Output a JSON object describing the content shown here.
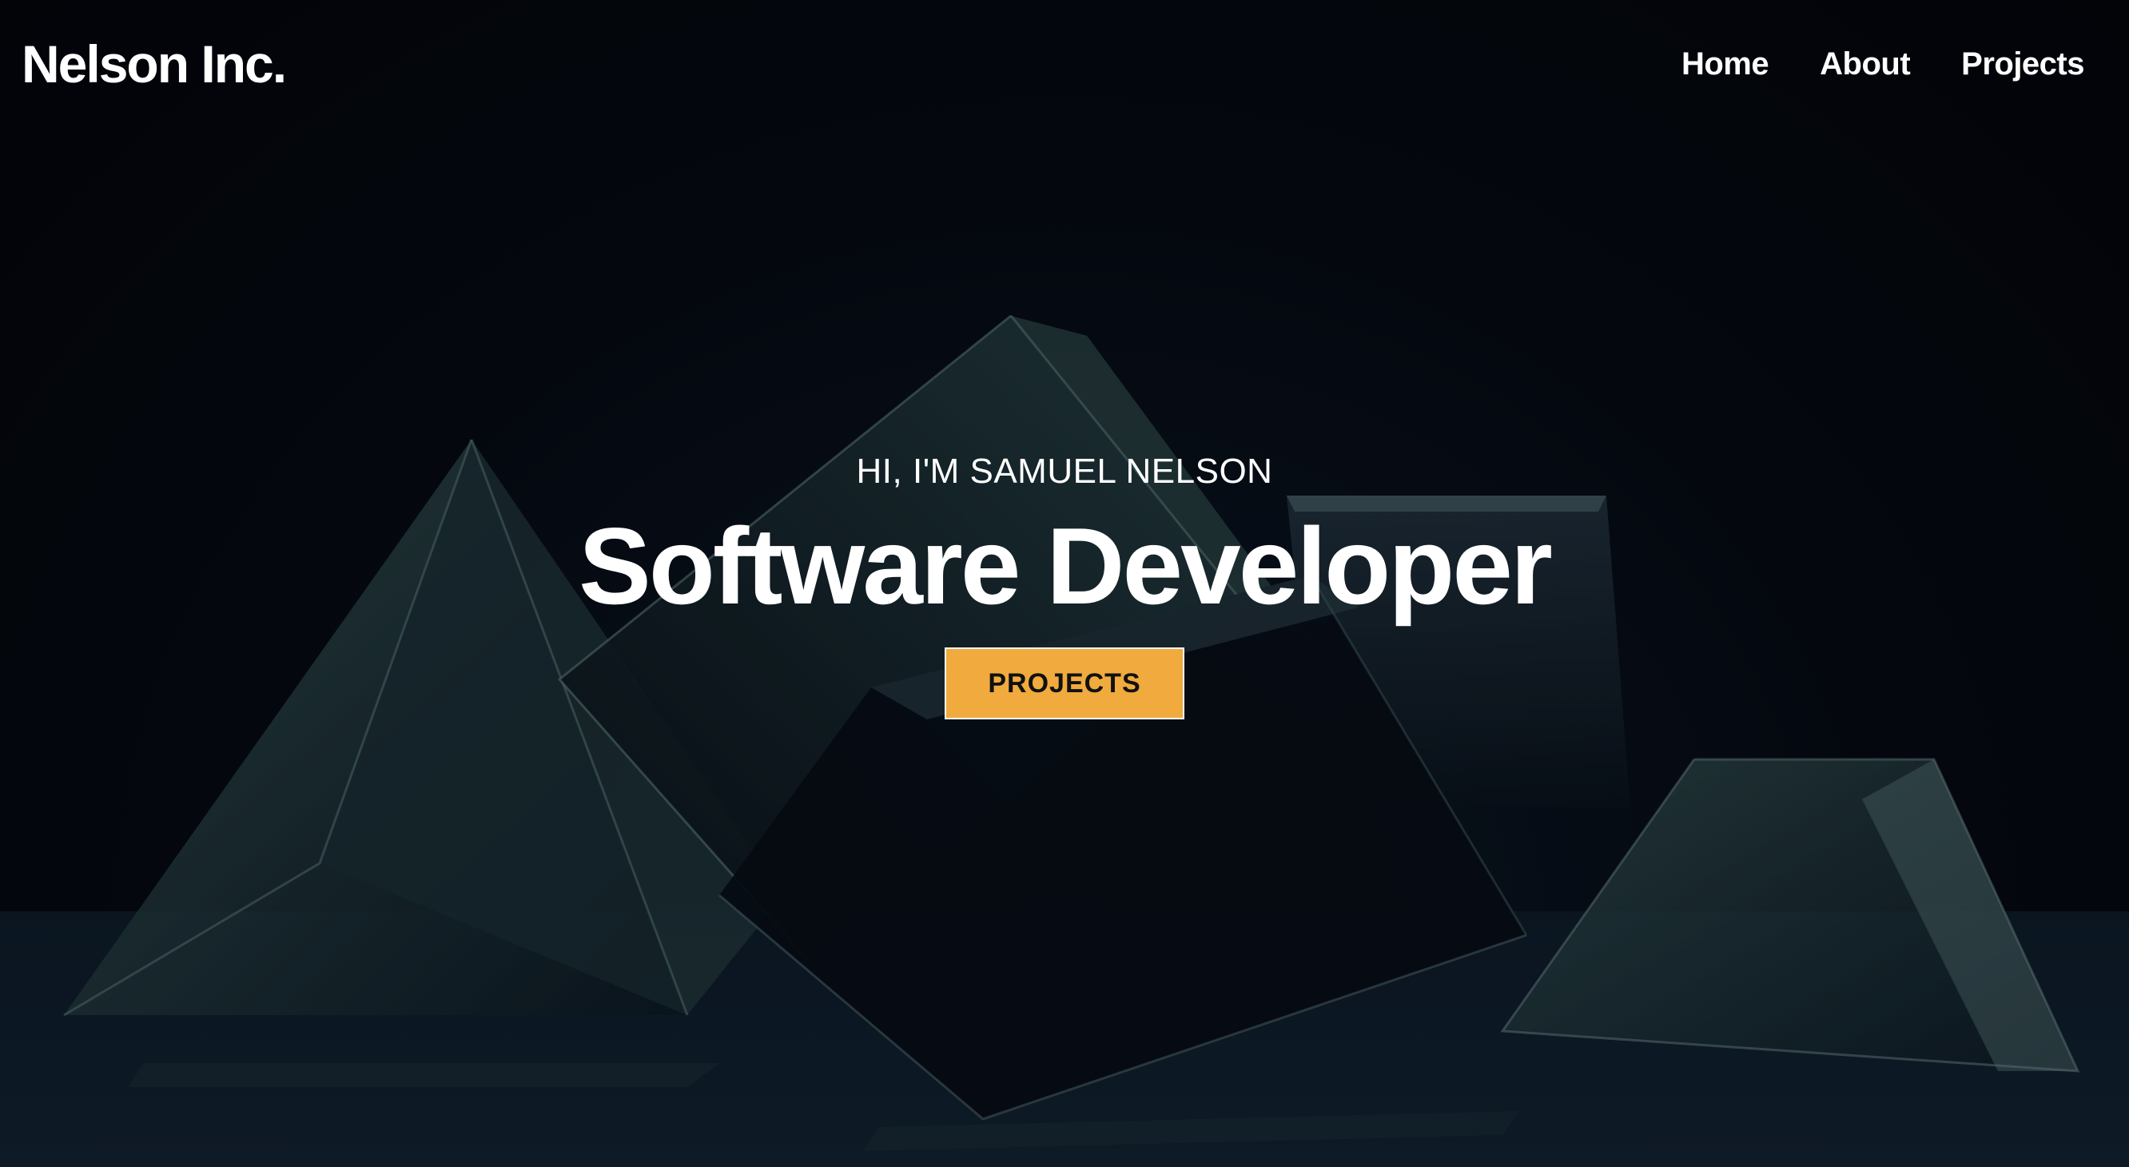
{
  "header": {
    "brand": "Nelson Inc.",
    "nav": [
      {
        "label": "Home"
      },
      {
        "label": "About"
      },
      {
        "label": "Projects"
      }
    ]
  },
  "hero": {
    "eyebrow": "HI, I'M SAMUEL NELSON",
    "headline": "Software Developer",
    "cta_label": "PROJECTS",
    "background_image": "glass-prisms"
  },
  "colors": {
    "cta_background": "#f0aa3e",
    "cta_text": "#111111",
    "overlay": "#03050b",
    "text": "#ffffff"
  }
}
